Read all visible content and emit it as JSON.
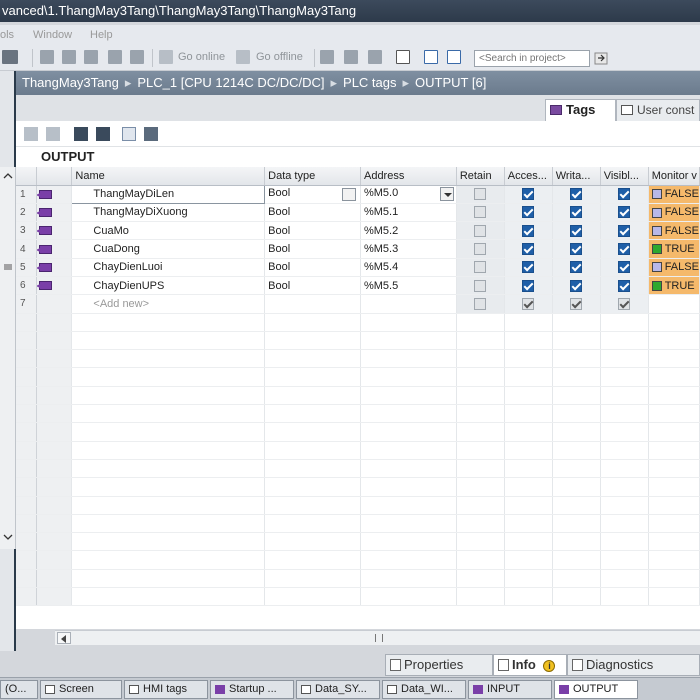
{
  "window": {
    "title": "vanced\\1.ThangMay3Tang\\ThangMay3Tang\\ThangMay3Tang"
  },
  "menu": {
    "items": [
      "ols",
      "Window",
      "Help"
    ]
  },
  "toolbar": {
    "go_online": "Go online",
    "go_offline": "Go offline",
    "search_placeholder": "<Search in project>"
  },
  "breadcrumb": [
    "ThangMay3Tang",
    "PLC_1 [CPU 1214C DC/DC/DC]",
    "PLC tags",
    "OUTPUT [6]"
  ],
  "tabs": {
    "tags": "Tags",
    "user_constants": "User const"
  },
  "table": {
    "title": "OUTPUT",
    "headers": {
      "name": "Name",
      "data_type": "Data type",
      "address": "Address",
      "retain": "Retain",
      "accessible": "Acces...",
      "writable": "Writa...",
      "visible": "Visibl...",
      "monitor": "Monitor v"
    },
    "rows": [
      {
        "num": "1",
        "name": "ThangMayDiLen",
        "type": "Bool",
        "address": "%M5.0",
        "monitor": "FALSE",
        "state": "false"
      },
      {
        "num": "2",
        "name": "ThangMayDiXuong",
        "type": "Bool",
        "address": "%M5.1",
        "monitor": "FALSE",
        "state": "false"
      },
      {
        "num": "3",
        "name": "CuaMo",
        "type": "Bool",
        "address": "%M5.2",
        "monitor": "FALSE",
        "state": "false"
      },
      {
        "num": "4",
        "name": "CuaDong",
        "type": "Bool",
        "address": "%M5.3",
        "monitor": "TRUE",
        "state": "true"
      },
      {
        "num": "5",
        "name": "ChayDienLuoi",
        "type": "Bool",
        "address": "%M5.4",
        "monitor": "FALSE",
        "state": "false"
      },
      {
        "num": "6",
        "name": "ChayDienUPS",
        "type": "Bool",
        "address": "%M5.5",
        "monitor": "TRUE",
        "state": "true"
      }
    ],
    "add_new": {
      "num": "7",
      "label": "<Add new>"
    }
  },
  "inspector_tabs": {
    "properties": "Properties",
    "info": "Info",
    "diagnostics": "Diagnostics"
  },
  "taskbar": {
    "items": [
      "(O...",
      "Screen",
      "HMI tags",
      "Startup ...",
      "Data_SY...",
      "Data_WI...",
      "INPUT",
      "OUTPUT"
    ]
  },
  "colors": {
    "monitor_bg": "#f5b96b",
    "true_indicator": "#2fa82f",
    "false_indicator": "#b8b8e8",
    "tag_icon": "#7a3fa8"
  }
}
